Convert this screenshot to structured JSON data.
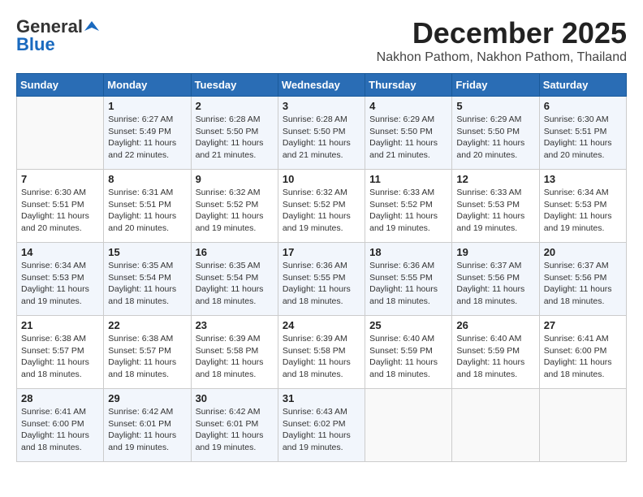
{
  "header": {
    "logo_general": "General",
    "logo_blue": "Blue",
    "month_title": "December 2025",
    "location": "Nakhon Pathom, Nakhon Pathom, Thailand"
  },
  "calendar": {
    "days_of_week": [
      "Sunday",
      "Monday",
      "Tuesday",
      "Wednesday",
      "Thursday",
      "Friday",
      "Saturday"
    ],
    "weeks": [
      [
        {
          "day": "",
          "sunrise": "",
          "sunset": "",
          "daylight": "",
          "empty": true
        },
        {
          "day": "1",
          "sunrise": "Sunrise: 6:27 AM",
          "sunset": "Sunset: 5:49 PM",
          "daylight": "Daylight: 11 hours and 22 minutes.",
          "empty": false
        },
        {
          "day": "2",
          "sunrise": "Sunrise: 6:28 AM",
          "sunset": "Sunset: 5:50 PM",
          "daylight": "Daylight: 11 hours and 21 minutes.",
          "empty": false
        },
        {
          "day": "3",
          "sunrise": "Sunrise: 6:28 AM",
          "sunset": "Sunset: 5:50 PM",
          "daylight": "Daylight: 11 hours and 21 minutes.",
          "empty": false
        },
        {
          "day": "4",
          "sunrise": "Sunrise: 6:29 AM",
          "sunset": "Sunset: 5:50 PM",
          "daylight": "Daylight: 11 hours and 21 minutes.",
          "empty": false
        },
        {
          "day": "5",
          "sunrise": "Sunrise: 6:29 AM",
          "sunset": "Sunset: 5:50 PM",
          "daylight": "Daylight: 11 hours and 20 minutes.",
          "empty": false
        },
        {
          "day": "6",
          "sunrise": "Sunrise: 6:30 AM",
          "sunset": "Sunset: 5:51 PM",
          "daylight": "Daylight: 11 hours and 20 minutes.",
          "empty": false
        }
      ],
      [
        {
          "day": "7",
          "sunrise": "Sunrise: 6:30 AM",
          "sunset": "Sunset: 5:51 PM",
          "daylight": "Daylight: 11 hours and 20 minutes.",
          "empty": false
        },
        {
          "day": "8",
          "sunrise": "Sunrise: 6:31 AM",
          "sunset": "Sunset: 5:51 PM",
          "daylight": "Daylight: 11 hours and 20 minutes.",
          "empty": false
        },
        {
          "day": "9",
          "sunrise": "Sunrise: 6:32 AM",
          "sunset": "Sunset: 5:52 PM",
          "daylight": "Daylight: 11 hours and 19 minutes.",
          "empty": false
        },
        {
          "day": "10",
          "sunrise": "Sunrise: 6:32 AM",
          "sunset": "Sunset: 5:52 PM",
          "daylight": "Daylight: 11 hours and 19 minutes.",
          "empty": false
        },
        {
          "day": "11",
          "sunrise": "Sunrise: 6:33 AM",
          "sunset": "Sunset: 5:52 PM",
          "daylight": "Daylight: 11 hours and 19 minutes.",
          "empty": false
        },
        {
          "day": "12",
          "sunrise": "Sunrise: 6:33 AM",
          "sunset": "Sunset: 5:53 PM",
          "daylight": "Daylight: 11 hours and 19 minutes.",
          "empty": false
        },
        {
          "day": "13",
          "sunrise": "Sunrise: 6:34 AM",
          "sunset": "Sunset: 5:53 PM",
          "daylight": "Daylight: 11 hours and 19 minutes.",
          "empty": false
        }
      ],
      [
        {
          "day": "14",
          "sunrise": "Sunrise: 6:34 AM",
          "sunset": "Sunset: 5:53 PM",
          "daylight": "Daylight: 11 hours and 19 minutes.",
          "empty": false
        },
        {
          "day": "15",
          "sunrise": "Sunrise: 6:35 AM",
          "sunset": "Sunset: 5:54 PM",
          "daylight": "Daylight: 11 hours and 18 minutes.",
          "empty": false
        },
        {
          "day": "16",
          "sunrise": "Sunrise: 6:35 AM",
          "sunset": "Sunset: 5:54 PM",
          "daylight": "Daylight: 11 hours and 18 minutes.",
          "empty": false
        },
        {
          "day": "17",
          "sunrise": "Sunrise: 6:36 AM",
          "sunset": "Sunset: 5:55 PM",
          "daylight": "Daylight: 11 hours and 18 minutes.",
          "empty": false
        },
        {
          "day": "18",
          "sunrise": "Sunrise: 6:36 AM",
          "sunset": "Sunset: 5:55 PM",
          "daylight": "Daylight: 11 hours and 18 minutes.",
          "empty": false
        },
        {
          "day": "19",
          "sunrise": "Sunrise: 6:37 AM",
          "sunset": "Sunset: 5:56 PM",
          "daylight": "Daylight: 11 hours and 18 minutes.",
          "empty": false
        },
        {
          "day": "20",
          "sunrise": "Sunrise: 6:37 AM",
          "sunset": "Sunset: 5:56 PM",
          "daylight": "Daylight: 11 hours and 18 minutes.",
          "empty": false
        }
      ],
      [
        {
          "day": "21",
          "sunrise": "Sunrise: 6:38 AM",
          "sunset": "Sunset: 5:57 PM",
          "daylight": "Daylight: 11 hours and 18 minutes.",
          "empty": false
        },
        {
          "day": "22",
          "sunrise": "Sunrise: 6:38 AM",
          "sunset": "Sunset: 5:57 PM",
          "daylight": "Daylight: 11 hours and 18 minutes.",
          "empty": false
        },
        {
          "day": "23",
          "sunrise": "Sunrise: 6:39 AM",
          "sunset": "Sunset: 5:58 PM",
          "daylight": "Daylight: 11 hours and 18 minutes.",
          "empty": false
        },
        {
          "day": "24",
          "sunrise": "Sunrise: 6:39 AM",
          "sunset": "Sunset: 5:58 PM",
          "daylight": "Daylight: 11 hours and 18 minutes.",
          "empty": false
        },
        {
          "day": "25",
          "sunrise": "Sunrise: 6:40 AM",
          "sunset": "Sunset: 5:59 PM",
          "daylight": "Daylight: 11 hours and 18 minutes.",
          "empty": false
        },
        {
          "day": "26",
          "sunrise": "Sunrise: 6:40 AM",
          "sunset": "Sunset: 5:59 PM",
          "daylight": "Daylight: 11 hours and 18 minutes.",
          "empty": false
        },
        {
          "day": "27",
          "sunrise": "Sunrise: 6:41 AM",
          "sunset": "Sunset: 6:00 PM",
          "daylight": "Daylight: 11 hours and 18 minutes.",
          "empty": false
        }
      ],
      [
        {
          "day": "28",
          "sunrise": "Sunrise: 6:41 AM",
          "sunset": "Sunset: 6:00 PM",
          "daylight": "Daylight: 11 hours and 18 minutes.",
          "empty": false
        },
        {
          "day": "29",
          "sunrise": "Sunrise: 6:42 AM",
          "sunset": "Sunset: 6:01 PM",
          "daylight": "Daylight: 11 hours and 19 minutes.",
          "empty": false
        },
        {
          "day": "30",
          "sunrise": "Sunrise: 6:42 AM",
          "sunset": "Sunset: 6:01 PM",
          "daylight": "Daylight: 11 hours and 19 minutes.",
          "empty": false
        },
        {
          "day": "31",
          "sunrise": "Sunrise: 6:43 AM",
          "sunset": "Sunset: 6:02 PM",
          "daylight": "Daylight: 11 hours and 19 minutes.",
          "empty": false
        },
        {
          "day": "",
          "sunrise": "",
          "sunset": "",
          "daylight": "",
          "empty": true
        },
        {
          "day": "",
          "sunrise": "",
          "sunset": "",
          "daylight": "",
          "empty": true
        },
        {
          "day": "",
          "sunrise": "",
          "sunset": "",
          "daylight": "",
          "empty": true
        }
      ]
    ]
  }
}
